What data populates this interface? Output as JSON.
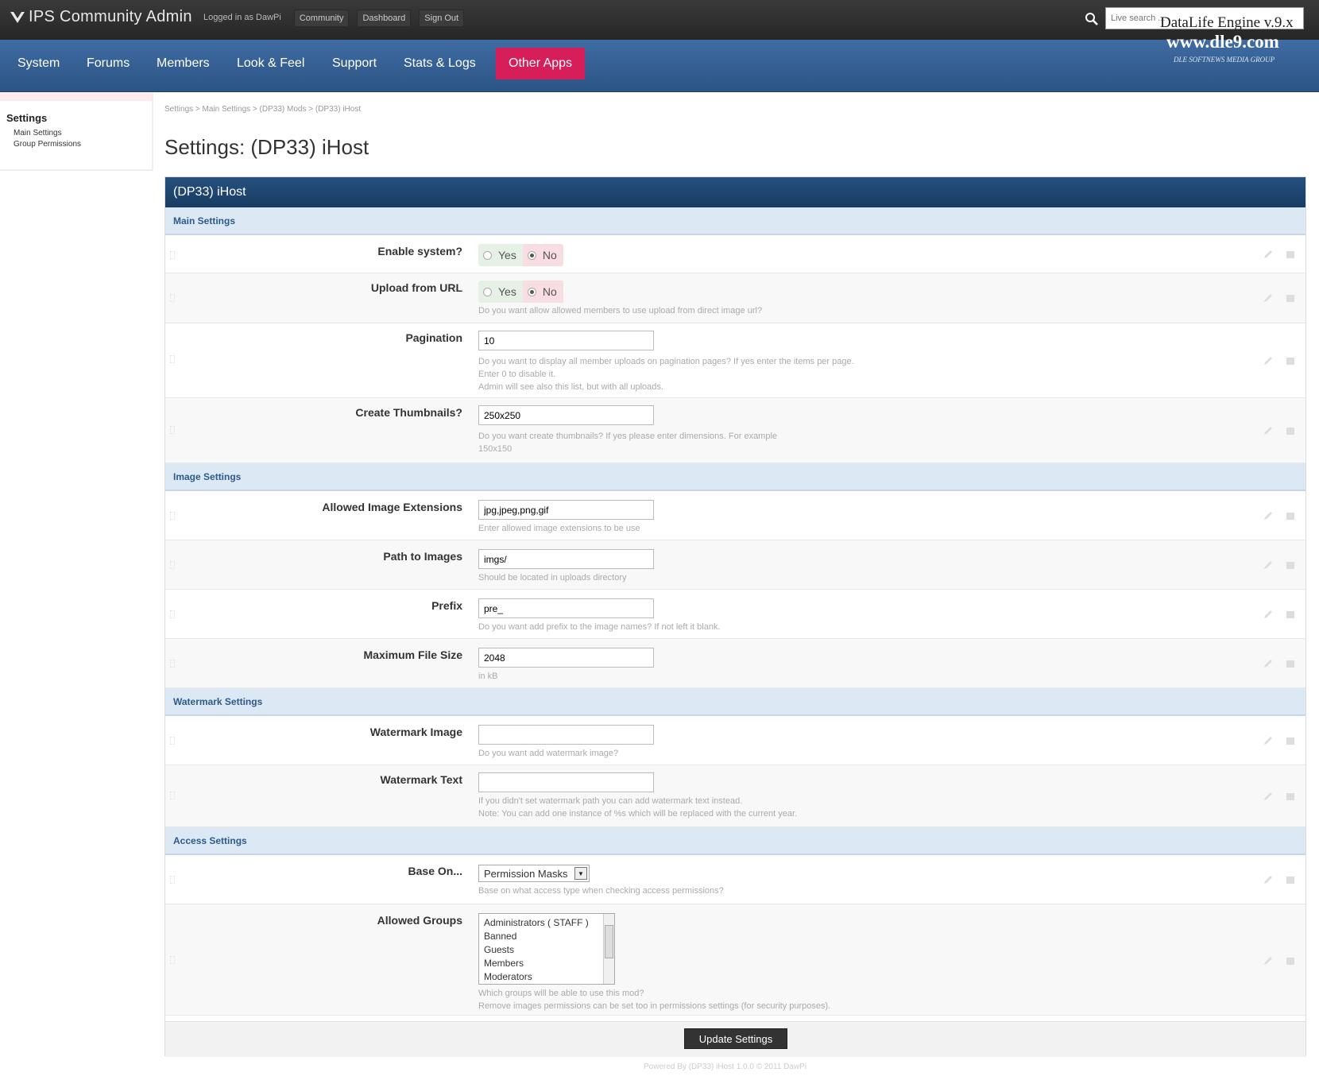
{
  "app": {
    "title": "IPS Community Admin",
    "logged_in": "Logged in as DawPi",
    "links": [
      "Community",
      "Dashboard",
      "Sign Out"
    ],
    "search_placeholder": "Live search ..."
  },
  "watermark": {
    "title": "DataLife Engine v.9.x",
    "site": "www.dle9.com",
    "group": "DLE SOFTNEWS MEDIA GROUP"
  },
  "nav": {
    "items": [
      "System",
      "Forums",
      "Members",
      "Look & Feel",
      "Support",
      "Stats & Logs",
      "Other Apps"
    ],
    "active": "Other Apps",
    "active_color": "#d61e5a"
  },
  "sidebar": {
    "title": "Settings",
    "links": [
      "Main Settings",
      "Group Permissions"
    ]
  },
  "breadcrumb": [
    "Settings",
    "Main Settings",
    "(DP33) Mods",
    "(DP33) iHost"
  ],
  "page_title": "Settings: (DP33) iHost",
  "panel_title": "(DP33) iHost",
  "sections": {
    "main": "Main Settings",
    "image": "Image Settings",
    "watermark": "Watermark Settings",
    "access": "Access Settings"
  },
  "settings": {
    "enable_system": {
      "label": "Enable system?",
      "yes": "Yes",
      "no": "No",
      "value": "No"
    },
    "upload_url": {
      "label": "Upload from URL",
      "yes": "Yes",
      "no": "No",
      "value": "No",
      "desc": "Do you want allow allowed members to use upload from direct image url?"
    },
    "pagination": {
      "label": "Pagination",
      "value": "10",
      "desc1": "Do you want to display all member uploads on pagination pages? If yes enter the items per page.",
      "desc2": "Enter 0 to disable it.",
      "desc3": "Admin will see also this list, but with all uploads."
    },
    "thumbnails": {
      "label": "Create Thumbnails?",
      "value": "250x250",
      "desc1": "Do you want create thumbnails? If yes please enter dimensions. For example",
      "desc2": "150x150"
    },
    "extensions": {
      "label": "Allowed Image Extensions",
      "value": "jpg,jpeg,png,gif",
      "desc": "Enter allowed image extensions to be use"
    },
    "path": {
      "label": "Path to Images",
      "value": "imgs/",
      "desc": "Should be located in uploads directory"
    },
    "prefix": {
      "label": "Prefix",
      "value": "pre_",
      "desc": "Do you want add prefix to the image names? If not left it blank."
    },
    "max_size": {
      "label": "Maximum File Size",
      "value": "2048",
      "desc": "in kB"
    },
    "wm_image": {
      "label": "Watermark Image",
      "value": "",
      "desc": "Do you want add watermark image?"
    },
    "wm_text": {
      "label": "Watermark Text",
      "value": "",
      "desc1": "If you didn't set watermark path you can add watermark text instead.",
      "desc2": "Note: You can add one instance of %s which will be replaced with the current year."
    },
    "base_on": {
      "label": "Base On...",
      "value": "Permission Masks",
      "desc": "Base on what access type when checking access permissions?"
    },
    "groups": {
      "label": "Allowed Groups",
      "options": [
        "Administrators ( STAFF )",
        "Banned",
        "Guests",
        "Members",
        "Moderators"
      ],
      "desc1": "Which groups will be able to use this mod?",
      "desc2": "Remove images permissions can be set too in permissions settings (for security purposes)."
    }
  },
  "update_button": "Update Settings",
  "powered_by": "Powered By (DP33) iHost 1.0.0 © 2011 DawPi"
}
